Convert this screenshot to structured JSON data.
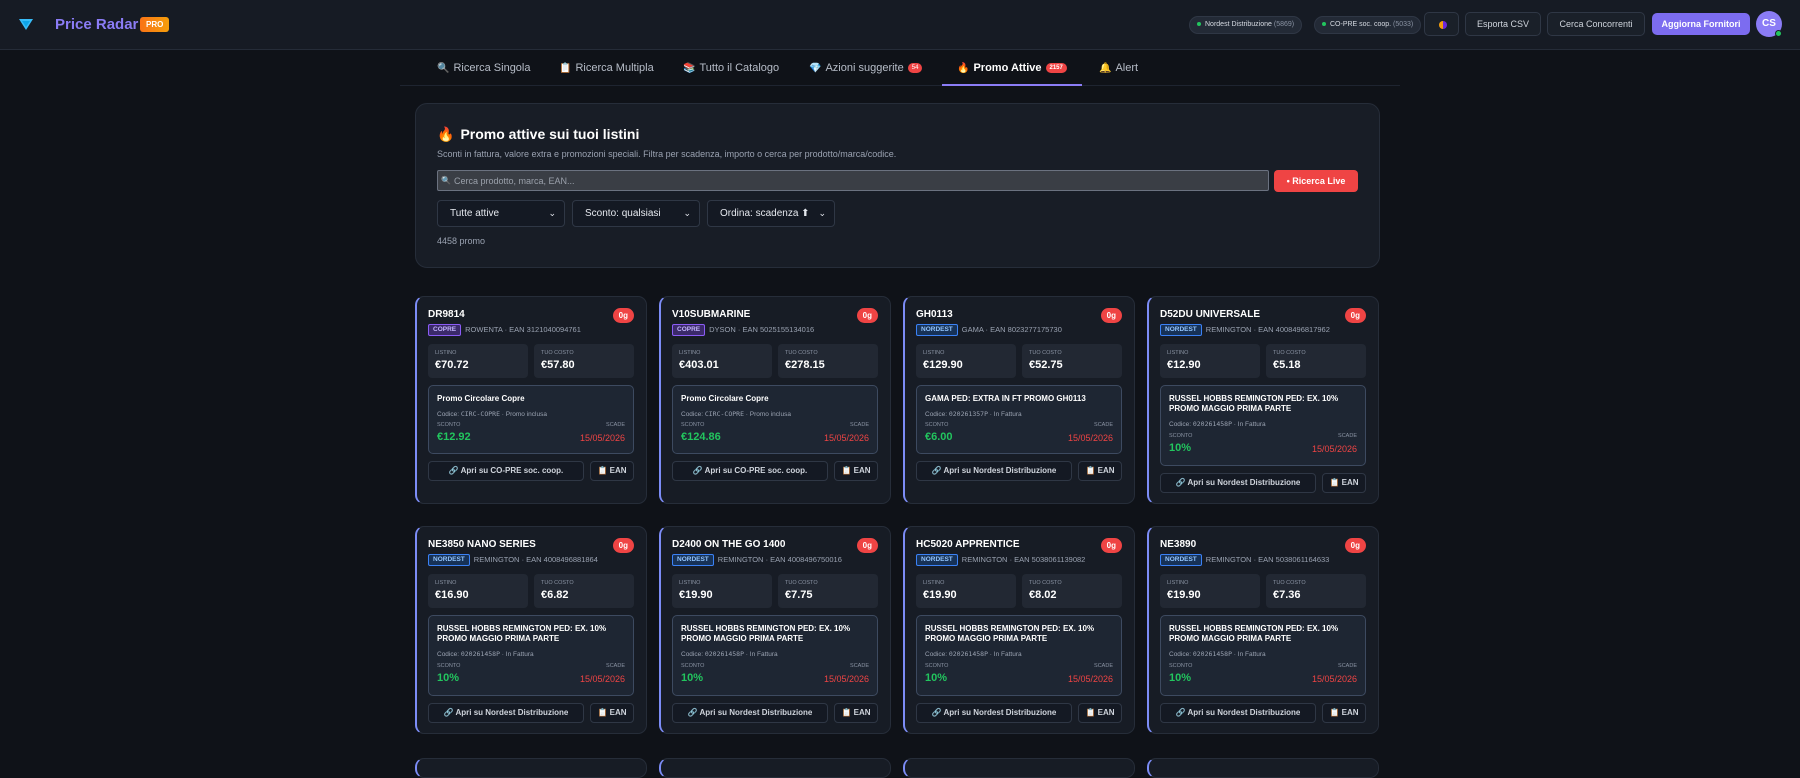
{
  "app": {
    "title": "Price Radar",
    "badge": "PRO",
    "suppliers": [
      {
        "name": "Nordest Distribuzione",
        "count": "(5869)"
      },
      {
        "name": "CO-PRE soc. coop.",
        "count": "(5033)"
      }
    ],
    "export_label": "Esporta CSV",
    "competitors_label": "Cerca Concorrenti",
    "update_label": "Aggiorna Fornitori",
    "user_initials": "CS"
  },
  "tabs": [
    {
      "icon": "🔍",
      "label": "Ricerca Singola"
    },
    {
      "icon": "📋",
      "label": "Ricerca Multipla"
    },
    {
      "icon": "📚",
      "label": "Tutto il Catalogo"
    },
    {
      "icon": "💎",
      "label": "Azioni suggerite",
      "badge": "54"
    },
    {
      "icon": "🔥",
      "label": "Promo Attive",
      "badge": "2157"
    },
    {
      "icon": "🔔",
      "label": "Alert"
    }
  ],
  "panel": {
    "title": "Promo attive sui tuoi listini",
    "subtitle": "Sconti in fattura, valore extra e promozioni speciali. Filtra per scadenza, importo o cerca per prodotto/marca/codice.",
    "search_placeholder": "Cerca prodotto, marca, EAN...",
    "live_label": "Ricerca Live",
    "filter_status": "Tutte attive",
    "filter_discount": "Sconto: qualsiasi",
    "filter_order": "Ordina: scadenza ⬆",
    "count_text": "4458 promo"
  },
  "labels": {
    "listino": "LISTINO",
    "tuo_costo": "TUO COSTO",
    "sconto": "SCONTO",
    "scade": "SCADE",
    "ean_button": "EAN",
    "codice_prefix": "Codice:"
  },
  "cards": [
    {
      "code": "DR9814",
      "days": "0g",
      "supplier": "COPRE",
      "brand": "ROWENTA",
      "ean": "EAN 3121040094761",
      "listino": "€70.72",
      "costo": "€57.80",
      "promo_title": "Promo Circolare Copre",
      "promo_code": "CIRC-COPRE",
      "promo_type": "Promo inclusa",
      "sconto": "€12.92",
      "scade": "15/05/2026",
      "open_label": "Apri su CO-PRE soc. coop."
    },
    {
      "code": "V10SUBMARINE",
      "days": "0g",
      "supplier": "COPRE",
      "brand": "DYSON",
      "ean": "EAN 5025155134016",
      "listino": "€403.01",
      "costo": "€278.15",
      "promo_title": "Promo Circolare Copre",
      "promo_code": "CIRC-COPRE",
      "promo_type": "Promo inclusa",
      "sconto": "€124.86",
      "scade": "15/05/2026",
      "open_label": "Apri su CO-PRE soc. coop."
    },
    {
      "code": "GH0113",
      "days": "0g",
      "supplier": "NORDEST",
      "brand": "GAMA",
      "ean": "EAN 8023277175730",
      "listino": "€129.90",
      "costo": "€52.75",
      "promo_title": "GAMA PED: EXTRA IN FT PROMO GH0113",
      "promo_code": "020261357P",
      "promo_type": "In Fattura",
      "sconto": "€6.00",
      "scade": "15/05/2026",
      "open_label": "Apri su Nordest Distribuzione"
    },
    {
      "code": "D52DU UNIVERSALE",
      "days": "0g",
      "supplier": "NORDEST",
      "brand": "REMINGTON",
      "ean": "EAN 4008496817962",
      "listino": "€12.90",
      "costo": "€5.18",
      "promo_title": "RUSSEL HOBBS REMINGTON PED: EX. 10% PROMO MAGGIO PRIMA PARTE",
      "promo_code": "020261458P",
      "promo_type": "In Fattura",
      "sconto": "10%",
      "scade": "15/05/2026",
      "open_label": "Apri su Nordest Distribuzione"
    },
    {
      "code": "NE3850 NANO SERIES",
      "days": "0g",
      "supplier": "NORDEST",
      "brand": "REMINGTON",
      "ean": "EAN 4008496881864",
      "listino": "€16.90",
      "costo": "€6.82",
      "promo_title": "RUSSEL HOBBS REMINGTON PED: EX. 10% PROMO MAGGIO PRIMA PARTE",
      "promo_code": "020261458P",
      "promo_type": "In Fattura",
      "sconto": "10%",
      "scade": "15/05/2026",
      "open_label": "Apri su Nordest Distribuzione"
    },
    {
      "code": "D2400 ON THE GO 1400",
      "days": "0g",
      "supplier": "NORDEST",
      "brand": "REMINGTON",
      "ean": "EAN 4008496750016",
      "listino": "€19.90",
      "costo": "€7.75",
      "promo_title": "RUSSEL HOBBS REMINGTON PED: EX. 10% PROMO MAGGIO PRIMA PARTE",
      "promo_code": "020261458P",
      "promo_type": "In Fattura",
      "sconto": "10%",
      "scade": "15/05/2026",
      "open_label": "Apri su Nordest Distribuzione"
    },
    {
      "code": "HC5020 APPRENTICE",
      "days": "0g",
      "supplier": "NORDEST",
      "brand": "REMINGTON",
      "ean": "EAN 5038061139082",
      "listino": "€19.90",
      "costo": "€8.02",
      "promo_title": "RUSSEL HOBBS REMINGTON PED: EX. 10% PROMO MAGGIO PRIMA PARTE",
      "promo_code": "020261458P",
      "promo_type": "In Fattura",
      "sconto": "10%",
      "scade": "15/05/2026",
      "open_label": "Apri su Nordest Distribuzione"
    },
    {
      "code": "NE3890",
      "days": "0g",
      "supplier": "NORDEST",
      "brand": "REMINGTON",
      "ean": "EAN 5038061164633",
      "listino": "€19.90",
      "costo": "€7.36",
      "promo_title": "RUSSEL HOBBS REMINGTON PED: EX. 10% PROMO MAGGIO PRIMA PARTE",
      "promo_code": "020261458P",
      "promo_type": "In Fattura",
      "sconto": "10%",
      "scade": "15/05/2026",
      "open_label": "Apri su Nordest Distribuzione"
    }
  ]
}
